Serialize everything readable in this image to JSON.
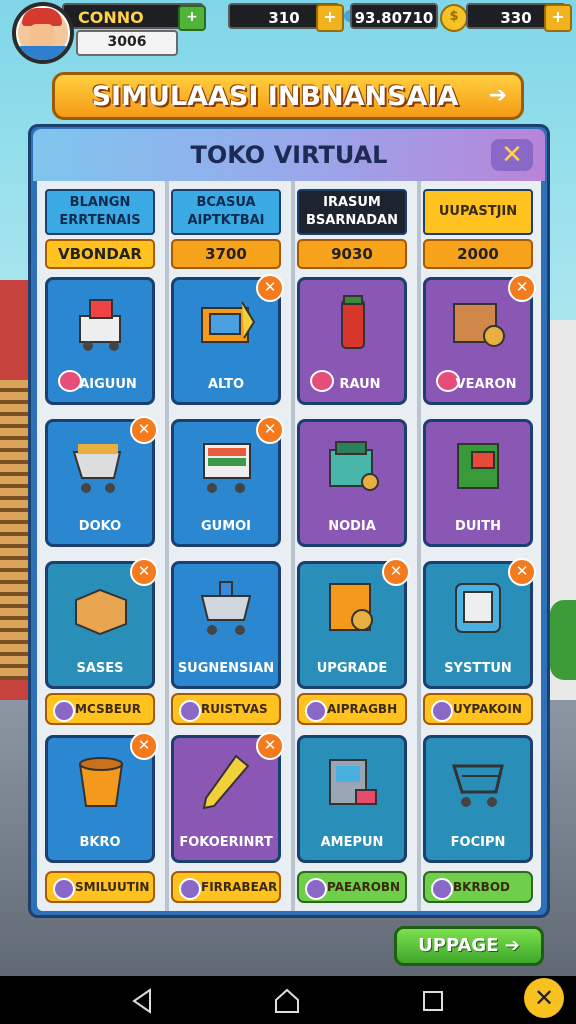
{
  "hud": {
    "player_name": "CONNO",
    "player_score": "3006",
    "resource1_value": "310",
    "resource2_value": "93.80710",
    "resource3_value": "330"
  },
  "banner": {
    "title": "SIMULAASI INBNANSAIA"
  },
  "panel": {
    "title": "TOKO VIRTUAL",
    "categories": [
      {
        "label": "BLANGN ERRTENAIS",
        "price": "VBONDAR",
        "header_color": "#3aa9e4",
        "price_color": "#ffc21f"
      },
      {
        "label": "BCASUA AIPTKTBAI",
        "price": "3700",
        "header_color": "#3aa9e4",
        "price_color": "#f7a21b"
      },
      {
        "label": "IRASUM BSARNADAN",
        "price": "9030",
        "header_color": "#1d2430",
        "price_color": "#f7a21b"
      },
      {
        "label": "UUPASTJIN",
        "price": "2000",
        "header_color": "#ffc21f",
        "price_color": "#f7a21b"
      }
    ],
    "items_row1": [
      {
        "label": "AIGUUN",
        "icon": "vending-cart-icon"
      },
      {
        "label": "ALTO",
        "icon": "crate-icon"
      },
      {
        "label": "RAUN",
        "icon": "soda-can-icon"
      },
      {
        "label": "VEARON",
        "icon": "package-icon"
      }
    ],
    "items_row2": [
      {
        "label": "DOKO",
        "icon": "shopping-cart-icon"
      },
      {
        "label": "GUMOI",
        "icon": "cart-display-icon"
      },
      {
        "label": "NODIA",
        "icon": "register-icon"
      },
      {
        "label": "DUITH",
        "icon": "vending-machine-icon"
      }
    ],
    "items_row3": [
      {
        "label": "SASES",
        "icon": "box-icon"
      },
      {
        "label": "SUGNENSIAN",
        "icon": "trolley-icon"
      },
      {
        "label": "UPGRADE",
        "icon": "safe-icon"
      },
      {
        "label": "SYSTTUN",
        "icon": "phone-device-icon"
      }
    ],
    "pills_row3": [
      "MCSBEUR",
      "RUISTVAS",
      "AIPRAGBH",
      "UYPAKOIN"
    ],
    "items_row4": [
      {
        "label": "BKRO",
        "icon": "bucket-icon"
      },
      {
        "label": "FOKOERINRT",
        "icon": "marker-icon"
      },
      {
        "label": "AMEPUN",
        "icon": "atm-icon"
      },
      {
        "label": "FOCIPN",
        "icon": "cart-icon"
      }
    ],
    "pills_row4": [
      "SMILUUTIN",
      "FIRRABEAR",
      "PAEAROBN",
      "BKRBOD"
    ]
  },
  "upgrade_button": {
    "label": "UPPAGE"
  },
  "colors": {
    "accent": "#f59a17",
    "panel": "#2f71b8",
    "green": "#3ea72a"
  }
}
